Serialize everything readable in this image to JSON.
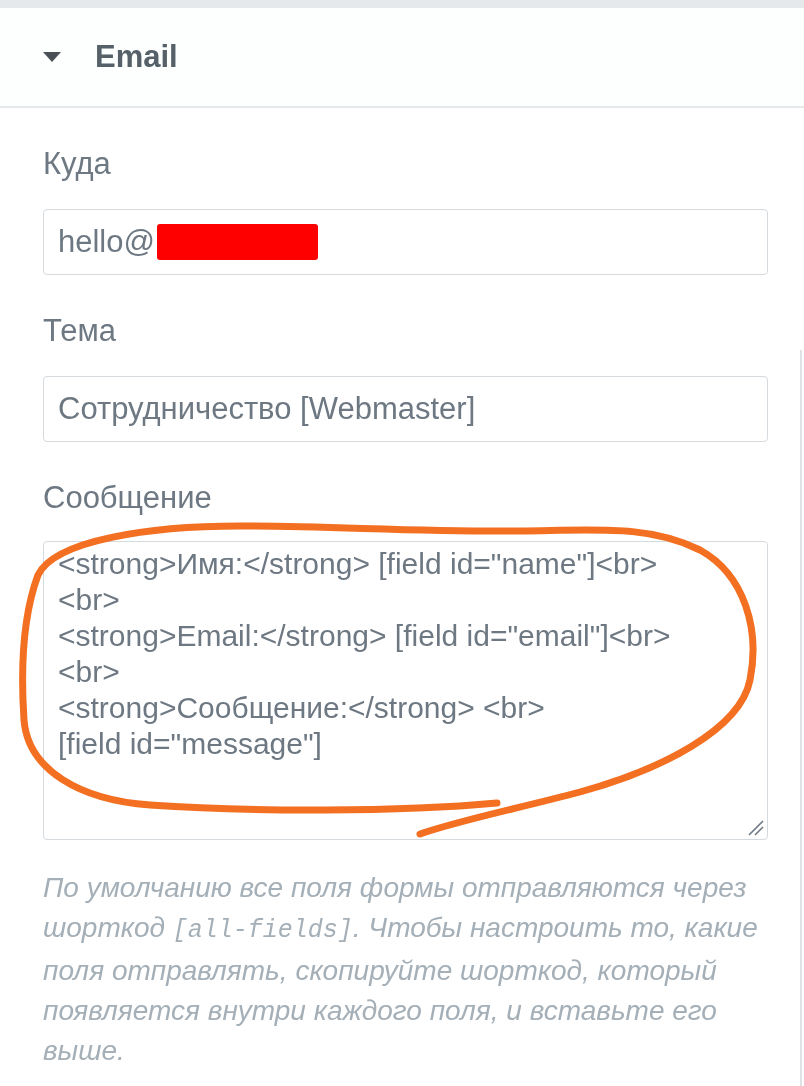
{
  "section": {
    "title": "Email",
    "expanded": true
  },
  "fields": [
    {
      "kind": "input",
      "label": "Куда",
      "value": "hello@",
      "redacted": true
    },
    {
      "kind": "input",
      "label": "Тема",
      "value": "Сотрудничество [Webmaster]",
      "redacted": false
    },
    {
      "kind": "textarea",
      "label": "Сообщение",
      "lines": [
        "<strong>Имя:</strong> [field id=\"name\"]<br>",
        "<br>",
        "<strong>Email:</strong> [field id=\"email\"]<br>",
        "<br>",
        "<strong>Сообщение:</strong> <br>",
        "[field id=\"message\"]"
      ]
    }
  ],
  "help": {
    "parts": [
      {
        "kind": "text",
        "text": "По умолчанию все поля формы отправляются через шорткод "
      },
      {
        "kind": "code",
        "text": "[all-fields]"
      },
      {
        "kind": "text",
        "text": ". Чтобы настроить то, какие поля отправлять, скопируйте шорткод, который появляется внутри каждого поля, и вставьте его выше."
      }
    ]
  }
}
